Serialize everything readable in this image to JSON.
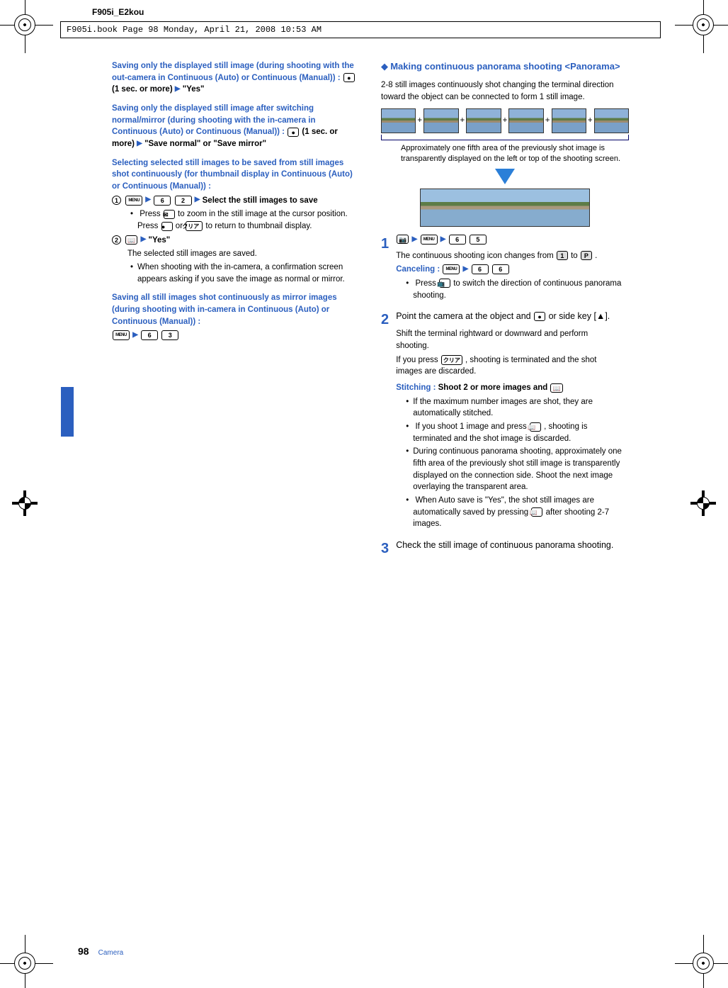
{
  "doc_id": "F905i_E2kou",
  "cropline": "F905i.book  Page 98  Monday, April 21, 2008  10:53 AM",
  "page_number": "98",
  "footer_section": "Camera",
  "left": {
    "h1_a": "Saving only the displayed still image (during shooting with the out-camera in Continuous (Auto) or Continuous (Manual)) : ",
    "h1_b_key": "●",
    "h1_c": " (1 sec. or more)",
    "h1_d_arrow": "▶",
    "h1_e": "\"Yes\"",
    "h2_a": "Saving only the displayed still image after switching normal/mirror (during shooting with the in-camera in Continuous (Auto) or Continuous (Manual)) : ",
    "h2_b_key": "●",
    "h2_c": " (1 sec. or more)",
    "h2_d_arrow": "▶",
    "h2_e": "\"Save normal\" or \"Save mirror\"",
    "h3": "Selecting selected still images to be saved from still images shot continuously (for thumbnail display in Continuous (Auto) or Continuous (Manual)) :",
    "step1_num": "1",
    "step1_menu": "MENU",
    "step1_arrow1": "▶",
    "step1_k6": "6",
    "step1_k2": "2",
    "step1_arrow2": "▶",
    "step1_txt": "Select the still images to save",
    "step1_b1a": "Press ",
    "step1_b1key": "✉",
    "step1_b1b": " to zoom in the still image at the cursor position. Press ",
    "step1_b1kc": "●",
    "step1_b1c": " or ",
    "step1_b1kd": "クリア",
    "step1_b1d": " to return to thumbnail display.",
    "step2_num": "2",
    "step2_key": "📖",
    "step2_arrow": "▶",
    "step2_txt": "\"Yes\"",
    "step2_line": "The selected still images are saved.",
    "step2_b1": "When shooting with the in-camera, a confirmation screen appears asking if you save the image as normal or mirror.",
    "h4": "Saving all still images shot continuously as mirror images (during shooting with in-camera in Continuous (Auto) or Continuous (Manual)) :",
    "h4_menu": "MENU",
    "h4_arrow": "▶",
    "h4_k6": "6",
    "h4_k3": "3"
  },
  "right": {
    "title_dia": "◆",
    "title": "Making continuous panorama shooting <Panorama>",
    "intro": "2-8 still images continuously shot changing the terminal direction toward the object can be connected to form 1 still image.",
    "plus": "+",
    "caption": "Approximately one fifth area of the previously shot image is transparently displayed on the left or top of the shooting screen.",
    "s1_num": "1",
    "s1_camkey": "📷",
    "s1_arrow1": "▶",
    "s1_menu": "MENU",
    "s1_arrow2": "▶",
    "s1_k6": "6",
    "s1_k5": "5",
    "s1_line_a": "The continuous shooting icon changes from ",
    "s1_icon1": "1",
    "s1_line_b": " to ",
    "s1_icon2": "P",
    "s1_line_c": ".",
    "s1_cancel_label": "Canceling : ",
    "s1_cancel_menu": "MENU",
    "s1_cancel_arrow": "▶",
    "s1_cancel_k6": "6",
    "s1_cancel_k6b": "6",
    "s1_b1_a": "Press ",
    "s1_b1_key": "📺",
    "s1_b1_b": " to switch the direction of continuous panorama shooting.",
    "s2_num": "2",
    "s2_a": "Point the camera at the object and ",
    "s2_key": "●",
    "s2_b": " or side key [▲].",
    "s2_p1": "Shift the terminal rightward or downward and perform shooting.",
    "s2_p2a": "If you press ",
    "s2_p2key": "クリア",
    "s2_p2b": ", shooting is terminated and the shot images are discarded.",
    "s2_stitch_label": "Stitching : ",
    "s2_stitch_text": "Shoot 2 or more images and ",
    "s2_stitch_key": "📖",
    "s2_b1": "If the maximum number images are shot, they are automatically stitched.",
    "s2_b2a": "If you shoot 1 image and press ",
    "s2_b2key": "📖",
    "s2_b2b": ", shooting is terminated and the shot image is discarded.",
    "s2_b3": "During continuous panorama shooting, approximately one fifth area of the previously shot still image is transparently displayed on the connection side. Shoot the next image overlaying the transparent area.",
    "s2_b4a": "When Auto save is \"Yes\", the shot still images are automatically saved by pressing ",
    "s2_b4key": "📖",
    "s2_b4b": " after shooting 2-7 images.",
    "s3_num": "3",
    "s3_txt": "Check the still image of continuous panorama shooting."
  }
}
